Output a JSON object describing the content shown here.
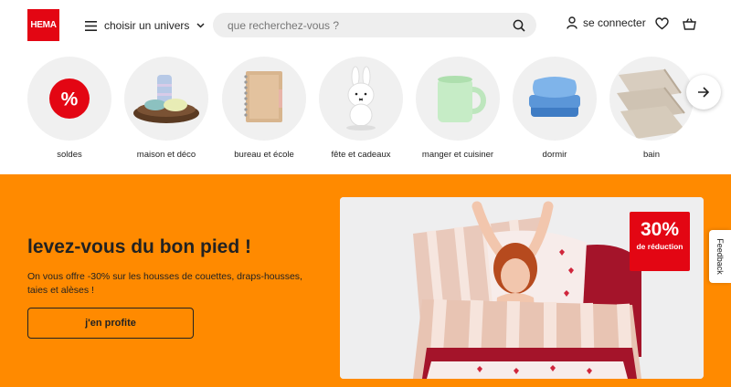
{
  "header": {
    "logo_text": "HEMA",
    "menu_label": "choisir un univers",
    "search_placeholder": "que recherchez-vous ?",
    "login_label": "se connecter"
  },
  "categories": [
    {
      "label": "soldes",
      "icon": "percent-badge"
    },
    {
      "label": "maison et déco",
      "icon": "candle-tray"
    },
    {
      "label": "bureau et école",
      "icon": "notebook"
    },
    {
      "label": "fête et cadeaux",
      "icon": "bunny-lamp"
    },
    {
      "label": "manger et cuisiner",
      "icon": "mug"
    },
    {
      "label": "dormir",
      "icon": "pillows"
    },
    {
      "label": "bain",
      "icon": "towels"
    }
  ],
  "banner": {
    "title": "levez-vous du bon pied !",
    "subtitle": "On vous offre -30% sur les housses de couettes, draps-housses, taies et alèses !",
    "cta_label": "j'en profite",
    "promo_value": "30%",
    "promo_text": "de réduction"
  },
  "feedback_label": "Feedback",
  "colors": {
    "brand_red": "#e30613",
    "banner_orange": "#ff8a00"
  }
}
